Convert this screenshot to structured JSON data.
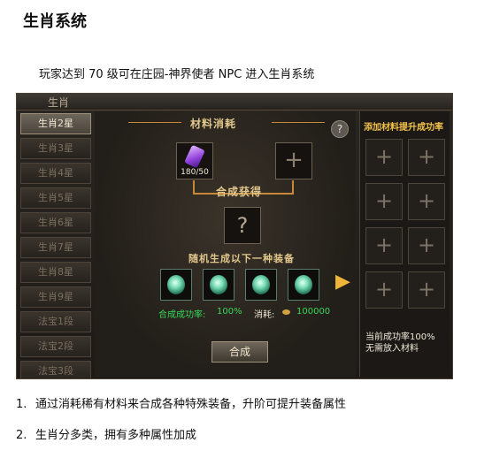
{
  "page": {
    "title": "生肖系统",
    "intro": "玩家达到 70 级可在庄园-神界使者 NPC 进入生肖系统",
    "notes": [
      {
        "num": "1.",
        "text": "通过消耗稀有材料来合成各种特殊装备，升阶可提升装备属性"
      },
      {
        "num": "2.",
        "text": "生肖分多类，拥有多种属性加成"
      }
    ]
  },
  "window": {
    "title": "生肖",
    "tabs": [
      "生肖2星",
      "生肖3星",
      "生肖4星",
      "生肖5星",
      "生肖6星",
      "生肖7星",
      "生肖8星",
      "生肖9星",
      "法宝1段",
      "法宝2段",
      "法宝3段"
    ],
    "active_tab_index": 0,
    "materials_label": "材料消耗",
    "material_count": "180/50",
    "synthesis_label": "合成获得",
    "random_label": "随机生成以下一种装备",
    "success_rate_label": "合成成功率:",
    "success_rate_value": "100%",
    "cost_label": "消耗:",
    "cost_value": "100000",
    "combine_button": "合成",
    "help_icon": "?",
    "right_panel_title": "添加材料提升成功率",
    "right_note_line1": "当前成功率100%",
    "right_note_line2": "无需放入材料",
    "colors": {
      "accent_gold": "#e2c78d",
      "green": "#39d65a",
      "title_yellow": "#f2c24b"
    }
  }
}
